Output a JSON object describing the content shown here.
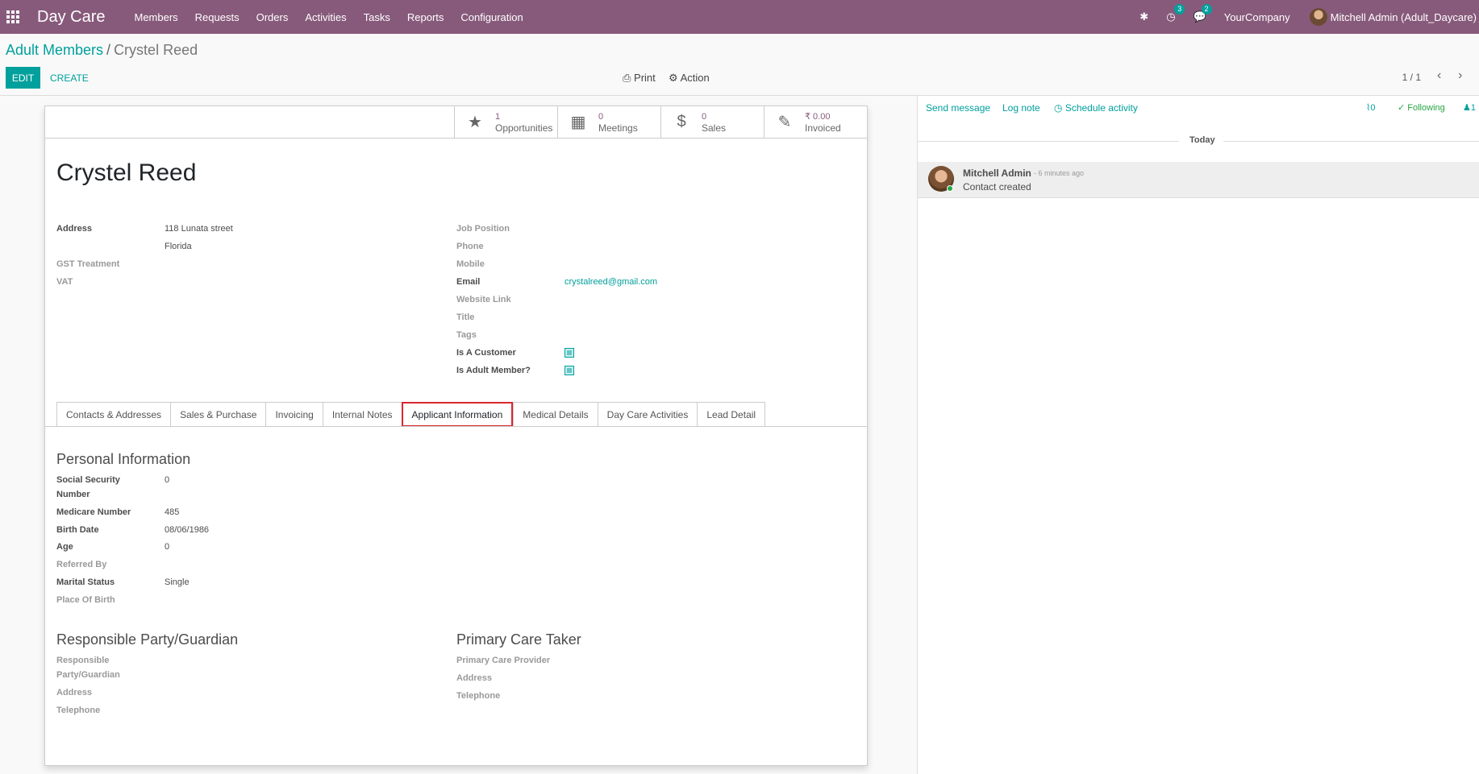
{
  "navbar": {
    "brand": "Day Care",
    "menu": [
      "Members",
      "Requests",
      "Orders",
      "Activities",
      "Tasks",
      "Reports",
      "Configuration"
    ],
    "activity_count": "3",
    "message_count": "2",
    "company": "YourCompany",
    "user": "Mitchell Admin (Adult_Daycare)"
  },
  "breadcrumb": {
    "parent": "Adult Members",
    "separator": "/",
    "current": "Crystel Reed"
  },
  "controls": {
    "edit": "EDIT",
    "create": "CREATE",
    "print": "Print",
    "action": "Action",
    "pager": "1 / 1"
  },
  "smart_buttons": [
    {
      "value": "1",
      "label": "Opportunities",
      "icon": "star-icon"
    },
    {
      "value": "0",
      "label": "Meetings",
      "icon": "calendar-icon"
    },
    {
      "value": "0",
      "label": "Sales",
      "icon": "dollar-icon"
    },
    {
      "value": "₹ 0.00",
      "label": "Invoiced",
      "icon": "edit-icon"
    }
  ],
  "record": {
    "name": "Crystel Reed",
    "left_fields": {
      "address_label": "Address",
      "address_line1": "118 Lunata street",
      "address_line2": "Florida",
      "gst_label": "GST Treatment",
      "vat_label": "VAT"
    },
    "right_fields": {
      "job_label": "Job Position",
      "phone_label": "Phone",
      "mobile_label": "Mobile",
      "email_label": "Email",
      "email_value": "crystalreed@gmail.com",
      "website_label": "Website Link",
      "title_label": "Title",
      "tags_label": "Tags",
      "customer_label": "Is A Customer",
      "adult_label": "Is Adult Member?"
    }
  },
  "tabs": [
    "Contacts & Addresses",
    "Sales & Purchase",
    "Invoicing",
    "Internal Notes",
    "Applicant Information",
    "Medical Details",
    "Day Care Activities",
    "Lead Detail"
  ],
  "personal": {
    "title": "Personal Information",
    "ssn_label_1": "Social Security",
    "ssn_label_2": "Number",
    "ssn_value": "0",
    "medicare_label": "Medicare Number",
    "medicare_value": "485",
    "birth_label": "Birth Date",
    "birth_value": "08/06/1986",
    "age_label": "Age",
    "age_value": "0",
    "referred_label": "Referred By",
    "marital_label": "Marital Status",
    "marital_value": "Single",
    "pob_label": "Place Of Birth"
  },
  "guardian": {
    "title": "Responsible Party/Guardian",
    "party_label_1": "Responsible",
    "party_label_2": "Party/Guardian",
    "address_label": "Address",
    "telephone_label": "Telephone"
  },
  "caretaker": {
    "title": "Primary Care Taker",
    "provider_label": "Primary Care Provider",
    "address_label": "Address",
    "telephone_label": "Telephone"
  },
  "chatter": {
    "send_message": "Send message",
    "log_note": "Log note",
    "schedule_activity": "Schedule activity",
    "attachments": "0",
    "following": "Following",
    "followers": "1",
    "today": "Today",
    "message": {
      "author": "Mitchell Admin",
      "time": "- 6 minutes ago",
      "body": "Contact created"
    }
  }
}
